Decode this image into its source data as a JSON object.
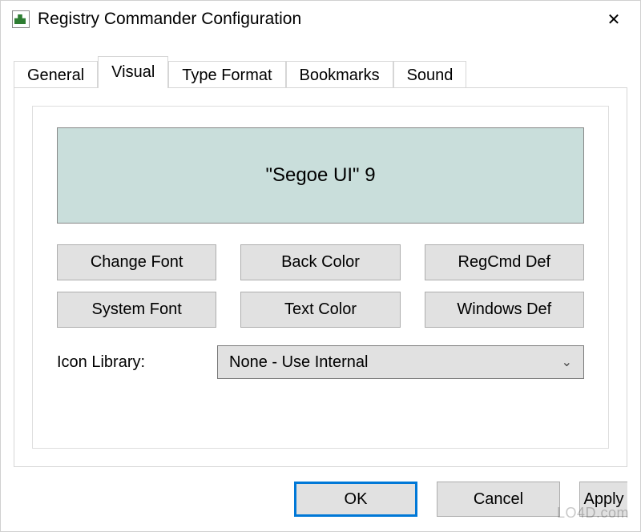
{
  "window": {
    "title": "Registry Commander Configuration",
    "icon_name": "app-icon"
  },
  "tabs": {
    "items": [
      {
        "label": "General"
      },
      {
        "label": "Visual"
      },
      {
        "label": "Type Format"
      },
      {
        "label": "Bookmarks"
      },
      {
        "label": "Sound"
      }
    ],
    "active_index": 1
  },
  "visual_tab": {
    "preview_text": "\"Segoe UI\" 9",
    "preview_bg": "#c9dedb",
    "buttons_row1": [
      {
        "label": "Change Font"
      },
      {
        "label": "Back Color"
      },
      {
        "label": "RegCmd Def"
      }
    ],
    "buttons_row2": [
      {
        "label": "System Font"
      },
      {
        "label": "Text Color"
      },
      {
        "label": "Windows Def"
      }
    ],
    "icon_library_label": "Icon Library:",
    "icon_library_value": "None - Use Internal"
  },
  "footer": {
    "ok_label": "OK",
    "cancel_label": "Cancel",
    "apply_label": "Apply"
  },
  "watermark": "LO4D.com"
}
